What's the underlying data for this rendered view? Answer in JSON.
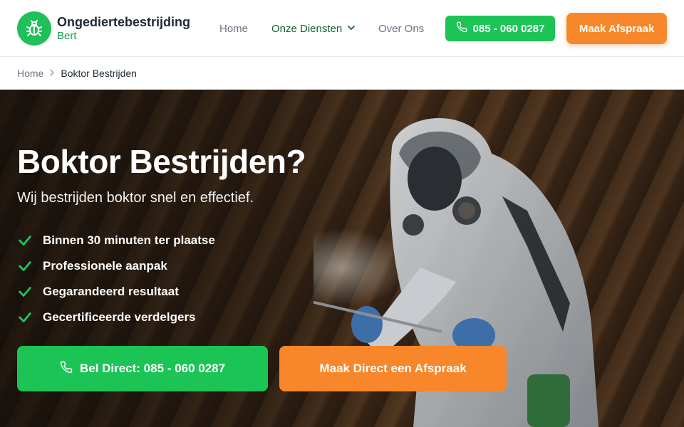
{
  "brand": {
    "name": "Ongediertebestrijding",
    "sub": "Bert",
    "icon": "bug-icon",
    "color": "#1fbf5a"
  },
  "nav": {
    "home": "Home",
    "services": "Onze Diensten",
    "about": "Over Ons"
  },
  "header": {
    "phone_label": "085 - 060 0287",
    "appointment_label": "Maak Afspraak"
  },
  "breadcrumb": {
    "home": "Home",
    "current": "Boktor Bestrijden"
  },
  "hero": {
    "title": "Boktor Bestrijden?",
    "subtitle": "Wij bestrijden boktor snel en effectief.",
    "features": [
      "Binnen 30 minuten ter plaatse",
      "Professionele aanpak",
      "Gegarandeerd resultaat",
      "Gecertificeerde verdelgers"
    ],
    "cta_call": "Bel Direct: 085 - 060 0287",
    "cta_appointment": "Maak Direct een Afspraak"
  },
  "colors": {
    "green": "#1cc456",
    "orange": "#f7872a",
    "check": "#22c55e"
  }
}
